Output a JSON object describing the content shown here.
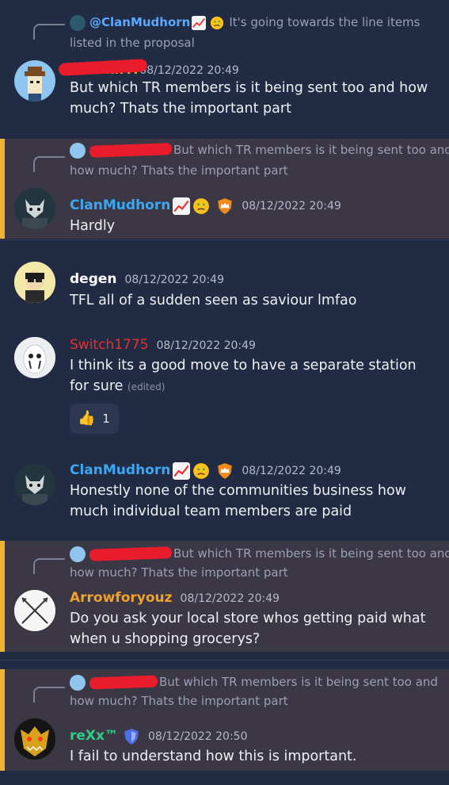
{
  "messages": {
    "m1": {
      "reply_author": "@ClanMudhorn",
      "reply_text": "It's going towards the line items",
      "reply_text2": "listed in the proposal",
      "author": "Ua...k..Tl",
      "timestamp": "08/12/2022 20:49",
      "content": "But which TR members is it being sent too and how much? Thats the important part"
    },
    "m2": {
      "reply_text": "But which TR members is it being sent too and",
      "reply_text2": "how much? Thats the important part",
      "author": "ClanMudhorn",
      "timestamp": "08/12/2022 20:49",
      "content": "Hardly"
    },
    "m3": {
      "author": "degen",
      "timestamp": "08/12/2022 20:49",
      "content": "TFL all of a sudden seen as saviour lmfao"
    },
    "m4": {
      "author": "Switch1775",
      "timestamp": "08/12/2022 20:49",
      "content": "I think its a good move to have a separate station for sure",
      "edited": "(edited)",
      "reaction_emoji": "👍",
      "reaction_count": "1"
    },
    "m5": {
      "author": "ClanMudhorn",
      "timestamp": "08/12/2022 20:49",
      "content": "Honestly none of the communities business how much individual team members are paid"
    },
    "m6": {
      "reply_text": "But which TR members is it being sent too and",
      "reply_text2": "how much? Thats the important part",
      "author": "Arrowforyouz",
      "timestamp": "08/12/2022 20:49",
      "content": "Do you ask your local store whos getting paid what when u shopping grocerys?"
    },
    "m7": {
      "reply_text": "But which TR members is it being sent too and",
      "reply_text2": "how much? Thats the important part",
      "author": "reXx™",
      "timestamp": "08/12/2022 20:50",
      "content": "I fail to understand how this is important."
    }
  },
  "colors": {
    "background": "#212b43",
    "highlight": "#3b3745",
    "highlight_bar": "#f0b232",
    "clanmudhorn": "#3aa8f5",
    "degen": "#ffffff",
    "switch": "#e8302f",
    "arrow": "#f0a229",
    "rexx": "#2ecf8a"
  },
  "icons": {
    "chart": "chart-increasing-icon",
    "thinking": "thinking-face-icon",
    "crown": "crown-badge-icon",
    "shield": "shield-badge-icon"
  }
}
